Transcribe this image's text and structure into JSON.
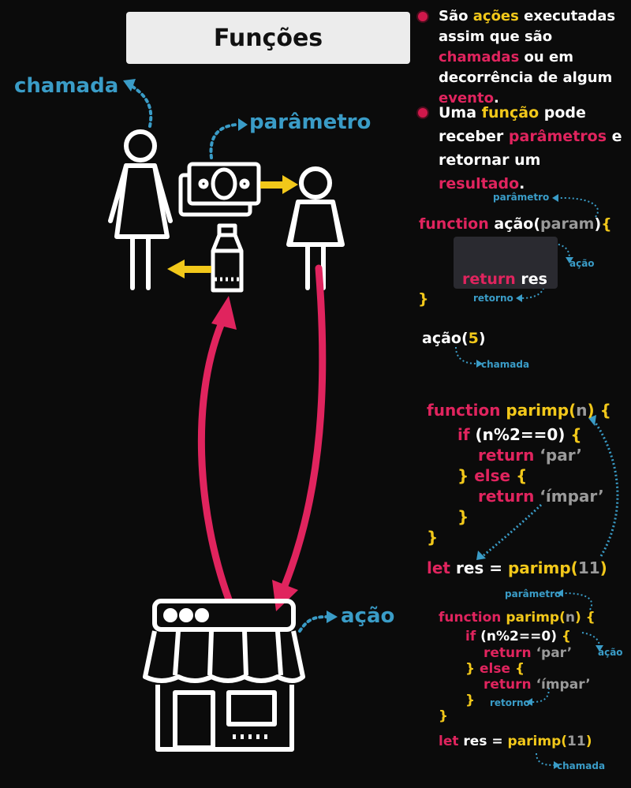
{
  "title": "Funções",
  "labels": {
    "chamada": "chamada",
    "parametro": "parâmetro",
    "acao": "ação"
  },
  "bullets": [
    {
      "parts": [
        {
          "t": "São ",
          "c": "w"
        },
        {
          "t": "ações",
          "c": "y"
        },
        {
          "t": " executadas assim que são ",
          "c": "w"
        },
        {
          "t": "chamadas",
          "c": "r"
        },
        {
          "t": " ou em decorrência de algum ",
          "c": "w"
        },
        {
          "t": "evento",
          "c": "r"
        },
        {
          "t": ".",
          "c": "w"
        }
      ]
    },
    {
      "parts": [
        {
          "t": "Uma ",
          "c": "w"
        },
        {
          "t": "função",
          "c": "y"
        },
        {
          "t": " pode receber ",
          "c": "w"
        },
        {
          "t": "parâmetros",
          "c": "r"
        },
        {
          "t": " e retornar um ",
          "c": "w"
        },
        {
          "t": "resultado",
          "c": "r"
        },
        {
          "t": ".",
          "c": "w"
        }
      ]
    }
  ],
  "code1": {
    "ann_param": "parâmetro",
    "ann_acao": "ação",
    "ann_retorno": "retorno",
    "ann_chamada": "chamada",
    "l1_kw": "function",
    "l1_name": "ação(",
    "l1_param": "param",
    "l1_end": ")",
    "l1_brace": "{",
    "l2_kw": "return",
    "l2_var": "res",
    "l3": "}",
    "call_name": "ação(",
    "call_arg": "5",
    "call_end": ")"
  },
  "code2": {
    "l1_kw": "function",
    "l1_name": "parimp(",
    "l1_param": "n",
    "l1_end": ")",
    "l1_brace": "{",
    "l2_if": "if",
    "l2_cond": "(n%2==0)",
    "l2_brace": "{",
    "l3_kw": "return",
    "l3_val": "‘par’",
    "l4_close": "}",
    "l4_else": "else",
    "l4_brace": "{",
    "l5_kw": "return",
    "l5_val": "‘ímpar’",
    "l6": "}",
    "l7": "}",
    "l8_let": "let",
    "l8_res": "res =",
    "l8_call": "parimp(",
    "l8_arg": "11",
    "l8_end": ")"
  },
  "code3": {
    "ann_param": "parâmetro",
    "ann_acao": "ação",
    "ann_retorno": "retorno",
    "ann_chamada": "chamada",
    "l1_kw": "function",
    "l1_name": "parimp(",
    "l1_param": "n",
    "l1_end": ")",
    "l1_brace": "{",
    "l2_if": "if",
    "l2_cond": "(n%2==0)",
    "l2_brace": "{",
    "l3_kw": "return",
    "l3_val": "‘par’",
    "l4_close": "}",
    "l4_else": "else",
    "l4_brace": "{",
    "l5_kw": "return",
    "l5_val": "‘ímpar’",
    "l6": "}",
    "l7": "}",
    "l8_let": "let",
    "l8_res": "res =",
    "l8_call": "parimp(",
    "l8_arg": "11",
    "l8_end": ")"
  },
  "colors": {
    "red": "#e0245e",
    "yellow": "#f2c81a",
    "blue": "#3a9cc7",
    "gray": "#9a9a9a"
  }
}
